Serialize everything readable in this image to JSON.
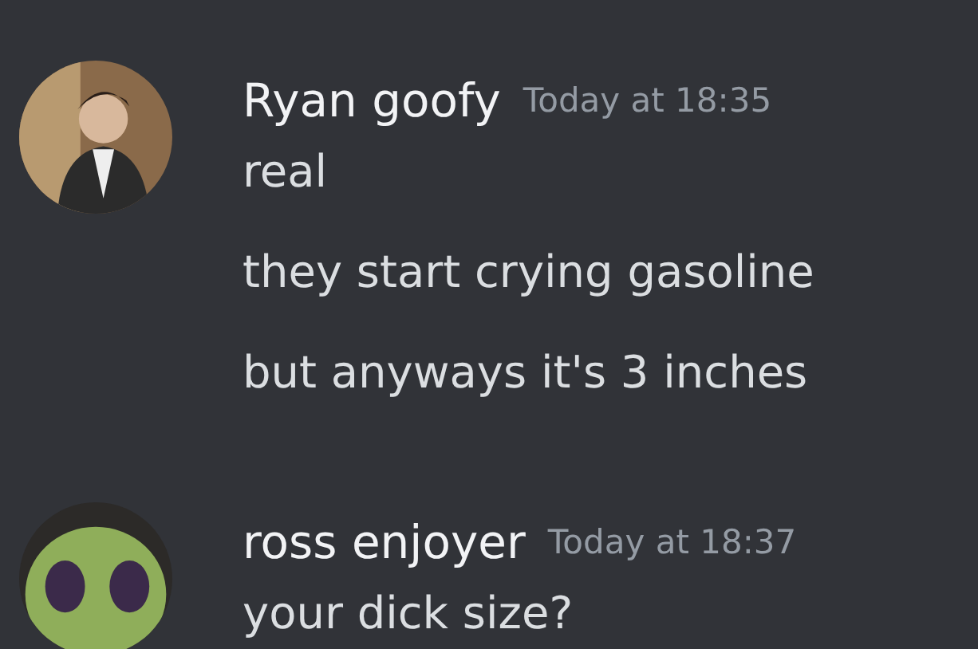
{
  "messages": [
    {
      "author": "Ryan goofy",
      "timestamp": "Today at 18:35",
      "avatar": {
        "kind": "picture"
      },
      "lines": [
        "real",
        "they start crying gasoline",
        "but anyways it's 3 inches"
      ]
    },
    {
      "author": "ross enjoyer",
      "timestamp": "Today at 18:37",
      "avatar": {
        "kind": "picture"
      },
      "lines": [
        "your dick size?"
      ]
    }
  ]
}
